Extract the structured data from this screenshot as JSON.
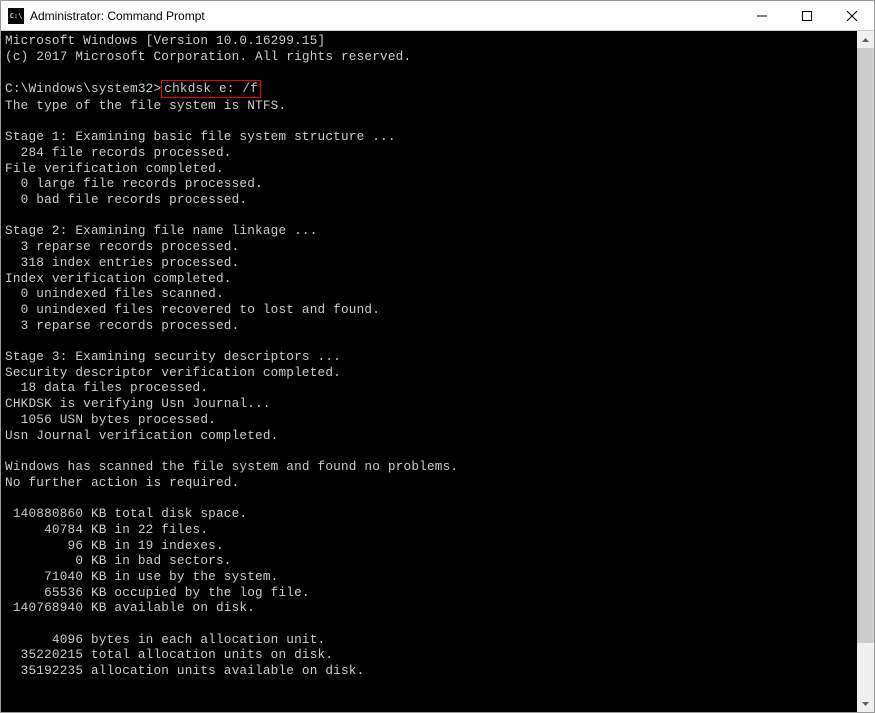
{
  "window": {
    "title": "Administrator: Command Prompt",
    "icon_label": "C:\\"
  },
  "terminal": {
    "line01": "Microsoft Windows [Version 10.0.16299.15]",
    "line02": "(c) 2017 Microsoft Corporation. All rights reserved.",
    "line03": "",
    "prompt": "C:\\Windows\\system32>",
    "command": "chkdsk e: /f",
    "line05": "The type of the file system is NTFS.",
    "line06": "",
    "line07": "Stage 1: Examining basic file system structure ...",
    "line08": "  284 file records processed.",
    "line09": "File verification completed.",
    "line10": "  0 large file records processed.",
    "line11": "  0 bad file records processed.",
    "line12": "",
    "line13": "Stage 2: Examining file name linkage ...",
    "line14": "  3 reparse records processed.",
    "line15": "  318 index entries processed.",
    "line16": "Index verification completed.",
    "line17": "  0 unindexed files scanned.",
    "line18": "  0 unindexed files recovered to lost and found.",
    "line19": "  3 reparse records processed.",
    "line20": "",
    "line21": "Stage 3: Examining security descriptors ...",
    "line22": "Security descriptor verification completed.",
    "line23": "  18 data files processed.",
    "line24": "CHKDSK is verifying Usn Journal...",
    "line25": "  1056 USN bytes processed.",
    "line26": "Usn Journal verification completed.",
    "line27": "",
    "line28": "Windows has scanned the file system and found no problems.",
    "line29": "No further action is required.",
    "line30": "",
    "line31": " 140880860 KB total disk space.",
    "line32": "     40784 KB in 22 files.",
    "line33": "        96 KB in 19 indexes.",
    "line34": "         0 KB in bad sectors.",
    "line35": "     71040 KB in use by the system.",
    "line36": "     65536 KB occupied by the log file.",
    "line37": " 140768940 KB available on disk.",
    "line38": "",
    "line39": "      4096 bytes in each allocation unit.",
    "line40": "  35220215 total allocation units on disk.",
    "line41": "  35192235 allocation units available on disk."
  }
}
